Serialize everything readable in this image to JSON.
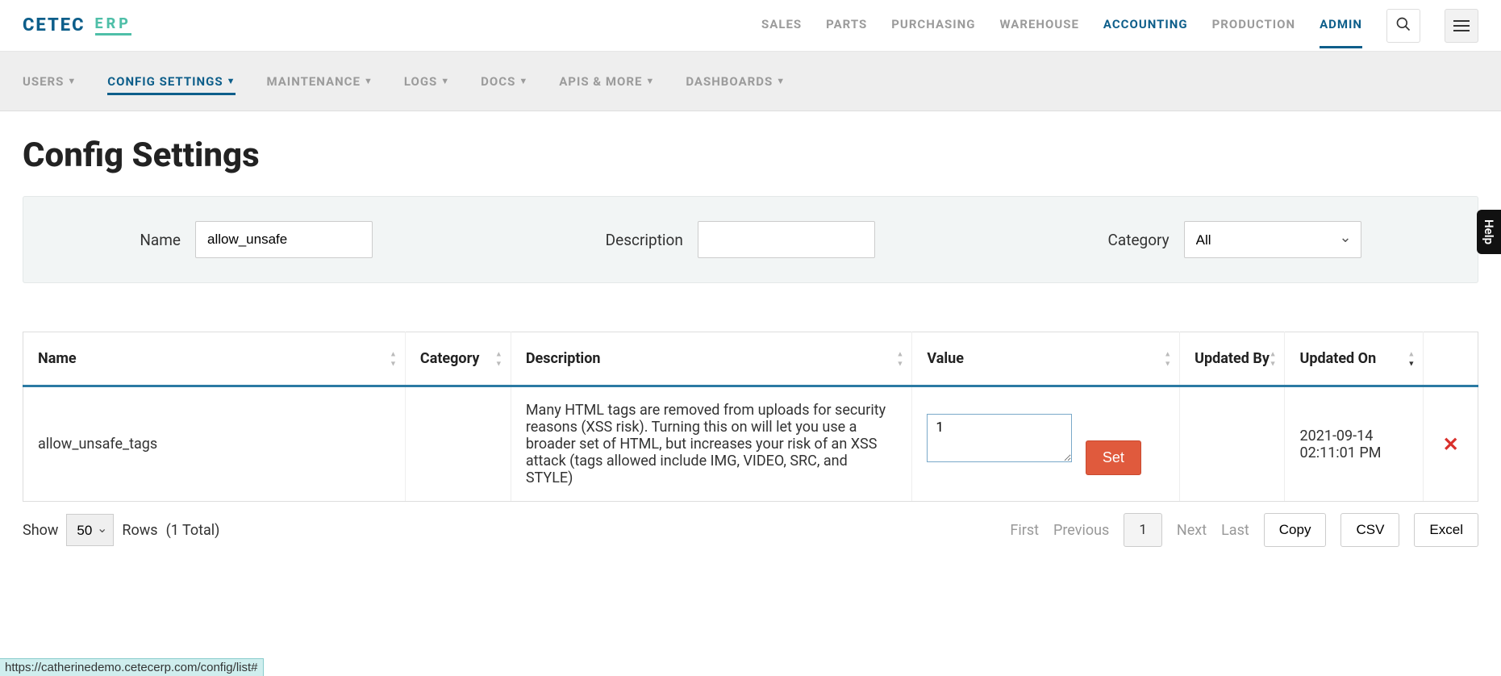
{
  "brand": {
    "name": "CETEC",
    "suffix": "ERP"
  },
  "topnav": {
    "items": [
      {
        "label": "SALES",
        "active": false
      },
      {
        "label": "PARTS",
        "active": false
      },
      {
        "label": "PURCHASING",
        "active": false
      },
      {
        "label": "WAREHOUSE",
        "active": false
      },
      {
        "label": "ACCOUNTING",
        "active": false,
        "semi": true
      },
      {
        "label": "PRODUCTION",
        "active": false
      },
      {
        "label": "ADMIN",
        "active": true
      }
    ]
  },
  "subnav": {
    "items": [
      {
        "label": "USERS",
        "active": false
      },
      {
        "label": "CONFIG SETTINGS",
        "active": true
      },
      {
        "label": "MAINTENANCE",
        "active": false
      },
      {
        "label": "LOGS",
        "active": false
      },
      {
        "label": "DOCS",
        "active": false
      },
      {
        "label": "APIS & MORE",
        "active": false
      },
      {
        "label": "DASHBOARDS",
        "active": false
      }
    ]
  },
  "page_title": "Config Settings",
  "filters": {
    "name_label": "Name",
    "name_value": "allow_unsafe",
    "description_label": "Description",
    "description_value": "",
    "category_label": "Category",
    "category_value": "All"
  },
  "table": {
    "headers": {
      "name": "Name",
      "category": "Category",
      "description": "Description",
      "value": "Value",
      "updated_by": "Updated By",
      "updated_on": "Updated On"
    },
    "rows": [
      {
        "name": "allow_unsafe_tags",
        "category": "",
        "description": "Many HTML tags are removed from uploads for security reasons (XSS risk). Turning this on will let you use a broader set of HTML, but increases your risk of an XSS attack (tags allowed include IMG, VIDEO, SRC, and STYLE)",
        "value": "1",
        "set_label": "Set",
        "updated_by": "",
        "updated_on": "2021-09-14 02:11:01 PM"
      }
    ]
  },
  "pager": {
    "show_label": "Show",
    "rows_label": "Rows",
    "rows_value": "50",
    "total_text": "(1 Total)",
    "first": "First",
    "previous": "Previous",
    "page": "1",
    "next": "Next",
    "last": "Last",
    "copy": "Copy",
    "csv": "CSV",
    "excel": "Excel"
  },
  "help_tab": "Help",
  "status_url": "https://catherinedemo.cetecerp.com/config/list#"
}
